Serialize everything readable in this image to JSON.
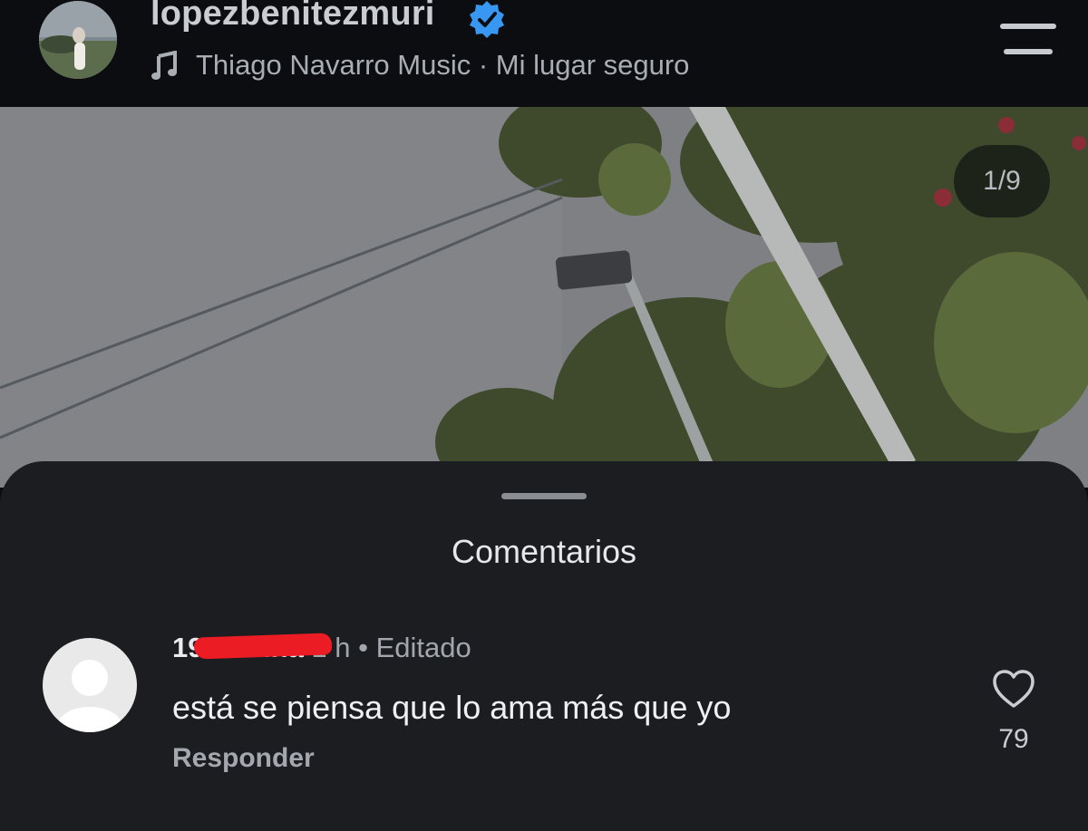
{
  "post": {
    "username": "lopezbenitezmuri",
    "music": "Thiago Navarro Music · Mi lugar seguro",
    "counter": "1/9"
  },
  "comments_sheet": {
    "title": "Comentarios",
    "comment": {
      "user": "19 marina",
      "time": "1 h",
      "separator": "•",
      "edited": "Editado",
      "text": "está se piensa que lo ama más que yo",
      "reply_label": "Responder",
      "likes": "79"
    }
  },
  "colors": {
    "verified": "#3897f0",
    "sheet_background": "#1b1d21",
    "redaction": "#ec1c24"
  },
  "icons": [
    "verified-icon",
    "music-note-icon",
    "menu-icon",
    "heart-icon",
    "default-avatar-icon"
  ]
}
